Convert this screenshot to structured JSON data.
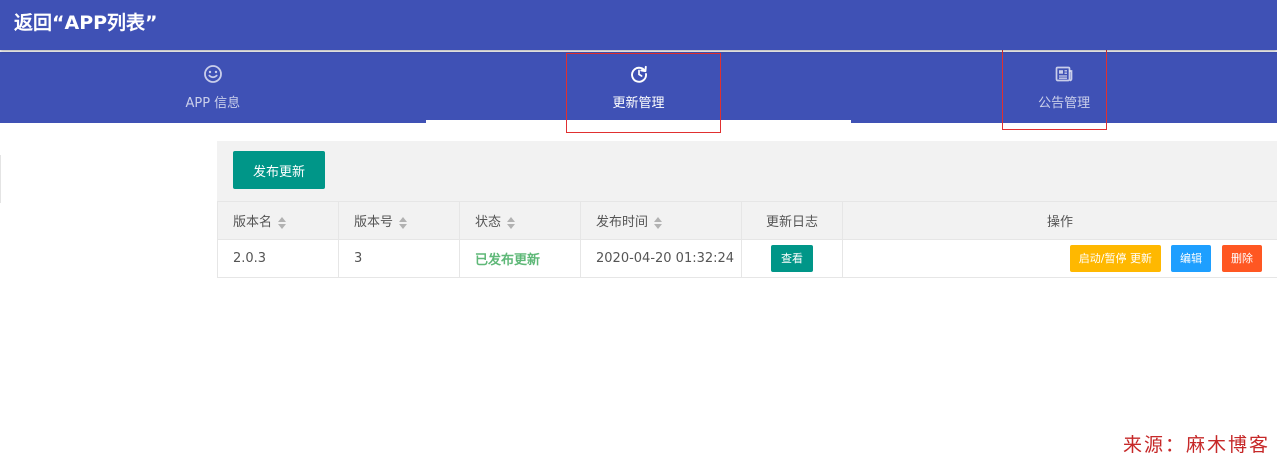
{
  "header": {
    "back_label": "返回“APP列表”"
  },
  "tabs": [
    {
      "label": "APP 信息",
      "icon": "smile-icon",
      "active": false
    },
    {
      "label": "更新管理",
      "icon": "refresh-clock-icon",
      "active": true
    },
    {
      "label": "公告管理",
      "icon": "newspaper-icon",
      "active": false
    }
  ],
  "toolbar": {
    "publish_label": "发布更新"
  },
  "table": {
    "columns": [
      "版本名",
      "版本号",
      "状态",
      "发布时间",
      "更新日志",
      "操作"
    ],
    "rows": [
      {
        "version_name": "2.0.3",
        "version_code": "3",
        "status": "已发布更新",
        "publish_time": "2020-04-20 01:32:24",
        "log_button": "查看",
        "actions": {
          "toggle": "启动/暂停 更新",
          "edit": "编辑",
          "delete": "删除"
        }
      }
    ]
  },
  "watermark": "来源：麻木博客",
  "colors": {
    "primary": "#3f51b5",
    "teal": "#009688",
    "warn": "#ffb800",
    "info": "#1e9fff",
    "danger": "#ff5722",
    "success_text": "#5fb878",
    "highlight_box": "#e03030",
    "watermark": "#c62828"
  }
}
